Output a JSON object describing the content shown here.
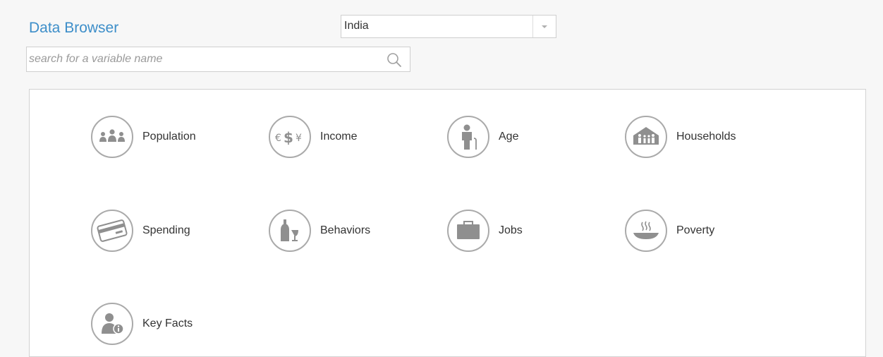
{
  "header": {
    "title": "Data Browser"
  },
  "country_select": {
    "value": "India"
  },
  "search": {
    "placeholder": "search for a variable name",
    "value": ""
  },
  "categories": [
    {
      "label": "Population",
      "icon": "population-icon"
    },
    {
      "label": "Income",
      "icon": "currency-icon"
    },
    {
      "label": "Age",
      "icon": "person-cane-icon"
    },
    {
      "label": "Households",
      "icon": "household-icon"
    },
    {
      "label": "Spending",
      "icon": "credit-card-icon"
    },
    {
      "label": "Behaviors",
      "icon": "bottle-glass-icon"
    },
    {
      "label": "Jobs",
      "icon": "briefcase-icon"
    },
    {
      "label": "Poverty",
      "icon": "empty-bowl-icon"
    },
    {
      "label": "Key Facts",
      "icon": "person-info-icon"
    }
  ],
  "colors": {
    "title": "#3d8ec9",
    "icon": "#8f8f8f",
    "icon_border": "#aaaaaa",
    "background": "#f7f7f7",
    "panel": "#ffffff"
  }
}
